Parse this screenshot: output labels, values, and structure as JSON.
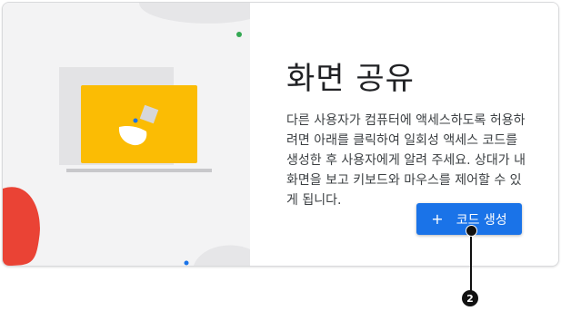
{
  "card": {
    "title": "화면 공유",
    "description": "다른 사용자가 컴퓨터에 액세스하도록 허용하려면 아래를 클릭하여 일회성 액세스 코드를 생성한 후 사용자에게 알려 주세요. 상대가 내 화면을 보고 키보드와 마우스를 제어할 수 있게 됩니다.",
    "button": {
      "icon": "+",
      "label": "코드 생성"
    }
  },
  "illustration": {
    "icon": "screen-share-illustration",
    "colors": {
      "screen": "#fbbc04",
      "blob": "#ea4335",
      "dot_green": "#34a853",
      "dot_blue": "#1a73e8"
    }
  },
  "callout": {
    "number": "2"
  }
}
